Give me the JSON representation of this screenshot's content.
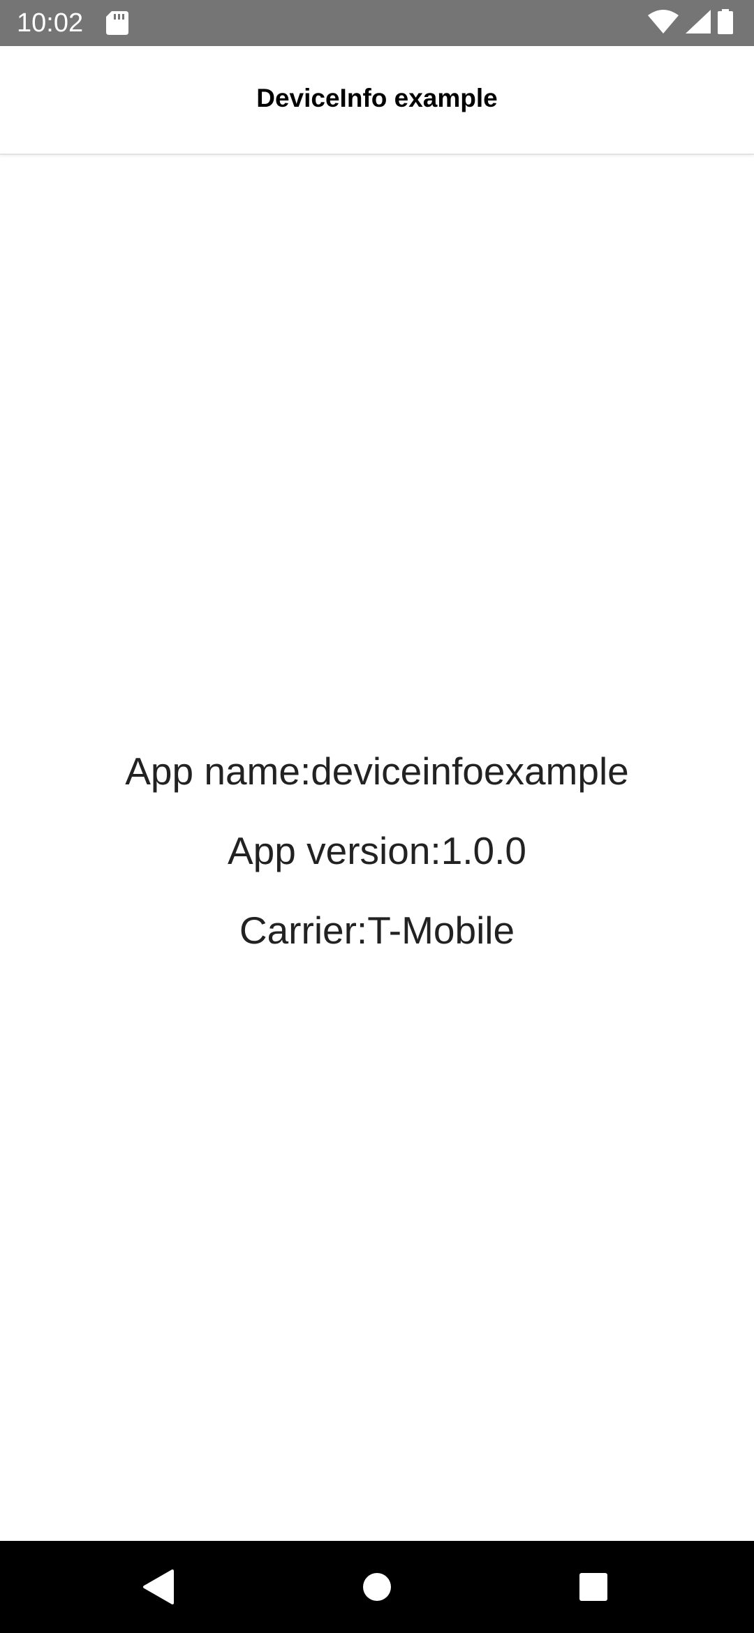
{
  "status_bar": {
    "time": "10:02",
    "icons": [
      "sd-card-icon",
      "wifi-icon",
      "signal-icon",
      "battery-icon"
    ]
  },
  "app_bar": {
    "title": "DeviceInfo example"
  },
  "device_info": {
    "app_name": "App name:deviceinfoexample",
    "app_version": "App version:1.0.0",
    "carrier": "Carrier:T-Mobile"
  },
  "nav_bar": {
    "buttons": [
      "back-icon",
      "home-icon",
      "recents-icon"
    ]
  },
  "colors": {
    "status_bar_bg": "#757575",
    "app_bar_bg": "#ffffff",
    "text": "#222222",
    "nav_bar_bg": "#000000"
  }
}
